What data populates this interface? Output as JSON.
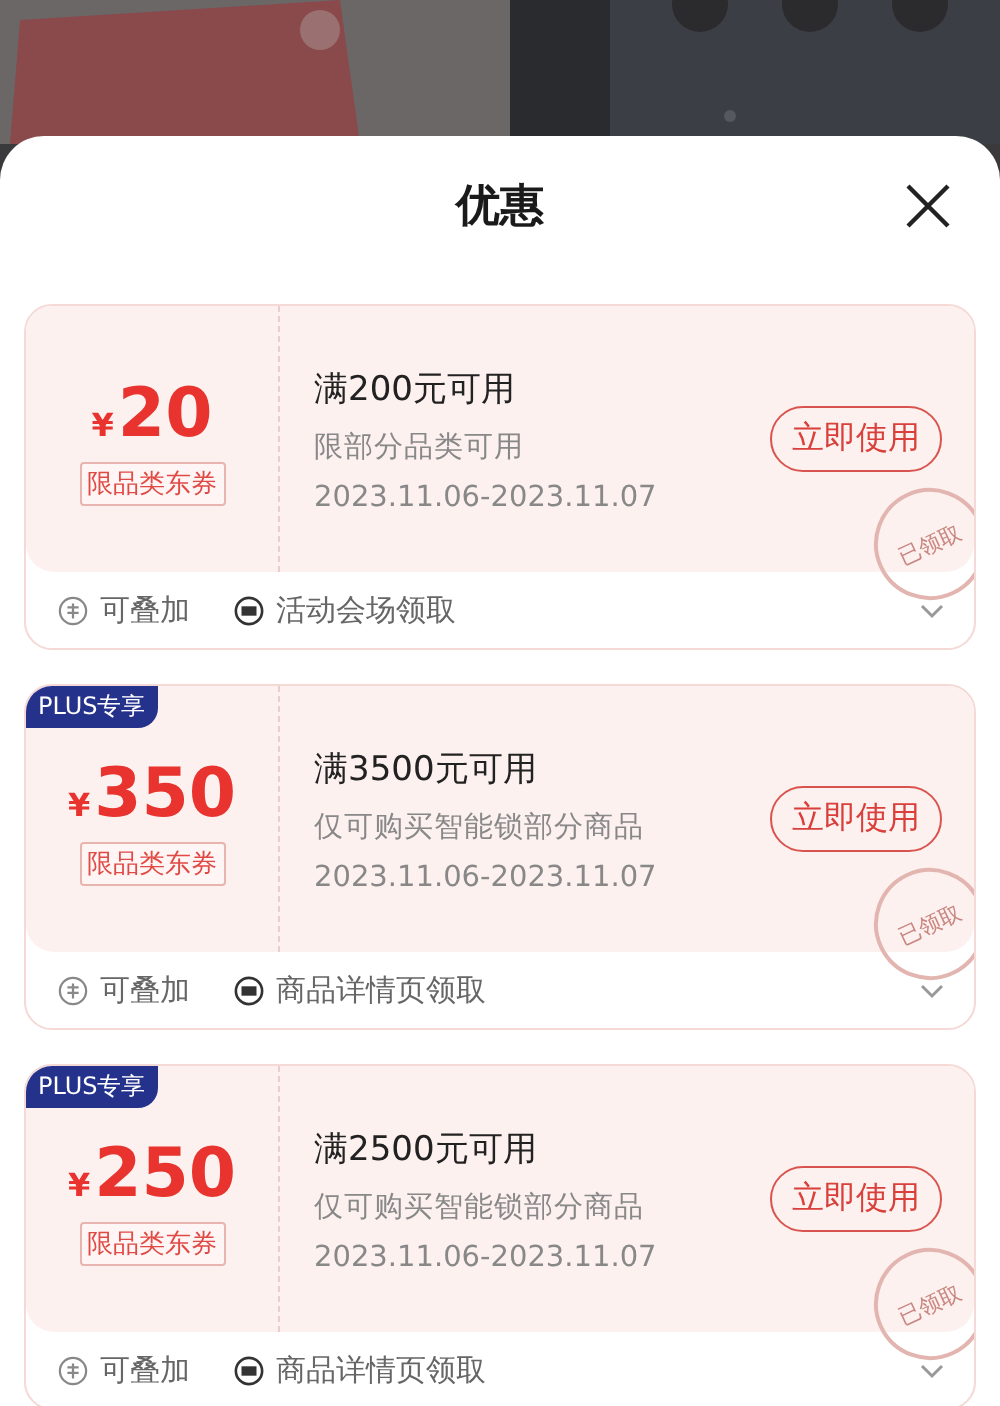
{
  "sheet": {
    "title": "优惠"
  },
  "coupons": [
    {
      "currency": "¥",
      "amount": "20",
      "tag": "限品类东券",
      "condition": "满200元可用",
      "scope": "限部分品类可用",
      "validity": "2023.11.06-2023.11.07",
      "button": "立即使用",
      "stamp": "已领取",
      "stackable": "可叠加",
      "source": "活动会场领取"
    },
    {
      "plus_badge": "PLUS专享",
      "currency": "¥",
      "amount": "350",
      "tag": "限品类东券",
      "condition": "满3500元可用",
      "scope": "仅可购买智能锁部分商品",
      "validity": "2023.11.06-2023.11.07",
      "button": "立即使用",
      "stamp": "已领取",
      "stackable": "可叠加",
      "source": "商品详情页领取"
    },
    {
      "plus_badge": "PLUS专享",
      "currency": "¥",
      "amount": "250",
      "tag": "限品类东券",
      "condition": "满2500元可用",
      "scope": "仅可购买智能锁部分商品",
      "validity": "2023.11.06-2023.11.07",
      "button": "立即使用",
      "stamp": "已领取",
      "stackable": "可叠加",
      "source": "商品详情页领取"
    }
  ]
}
